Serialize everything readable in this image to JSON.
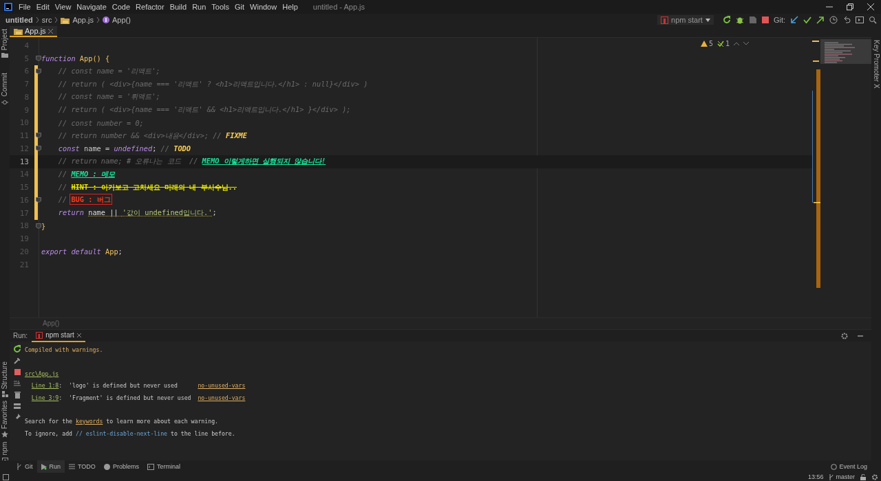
{
  "window": {
    "title": "untitled - App.js",
    "menu": [
      "File",
      "Edit",
      "View",
      "Navigate",
      "Code",
      "Refactor",
      "Build",
      "Run",
      "Tools",
      "Git",
      "Window",
      "Help"
    ]
  },
  "navbar": {
    "breadcrumbs": [
      {
        "label": "untitled",
        "kind": "project"
      },
      {
        "label": "src",
        "kind": "folder"
      },
      {
        "label": "App.js",
        "kind": "file"
      },
      {
        "label": "App()",
        "kind": "function"
      }
    ],
    "run_config": "npm start",
    "git_label": "Git:"
  },
  "left_tool_windows": [
    {
      "label": "Project",
      "kind": "folder"
    },
    {
      "label": "Commit",
      "kind": "commit"
    },
    {
      "label": "Structure",
      "kind": "structure"
    },
    {
      "label": "Favorites",
      "kind": "star"
    },
    {
      "label": "npm",
      "kind": "npm"
    }
  ],
  "right_tool_windows": [
    {
      "label": "Key Promoter X"
    }
  ],
  "editor": {
    "tabs": [
      {
        "label": "App.js",
        "selected": true
      }
    ],
    "inspections": {
      "warnings": "5",
      "weak_warnings": "1"
    },
    "lines": [
      {
        "number": "4",
        "changed": false,
        "current": false,
        "fold": false
      },
      {
        "number": "5",
        "changed": false,
        "current": false,
        "fold": true,
        "tokens": [
          {
            "kind": "keyword",
            "text": "function "
          },
          {
            "kind": "function",
            "text": "App() {"
          }
        ]
      },
      {
        "number": "6",
        "changed": true,
        "current": false,
        "fold": true,
        "tokens": [
          {
            "kind": "comment",
            "text": "    // const name = '리액트';"
          }
        ]
      },
      {
        "number": "7",
        "changed": true,
        "current": false,
        "fold": false,
        "tokens": [
          {
            "kind": "comment",
            "text": "    // return ( <div>{name === '리액트' ? <h1>리액트입니다.</h1> : null}</div> )"
          }
        ]
      },
      {
        "number": "8",
        "changed": true,
        "current": false,
        "fold": false,
        "tokens": [
          {
            "kind": "comment",
            "text": "    // const name = '뤼액트';"
          }
        ]
      },
      {
        "number": "9",
        "changed": true,
        "current": false,
        "fold": false,
        "tokens": [
          {
            "kind": "comment",
            "text": "    // return ( <div>{name === '리액트' && <h1>리액트입니다.</h1> }</div> );"
          }
        ]
      },
      {
        "number": "10",
        "changed": true,
        "current": false,
        "fold": false,
        "tokens": [
          {
            "kind": "comment",
            "text": "    // const number = 0;"
          }
        ]
      },
      {
        "number": "11",
        "changed": true,
        "current": false,
        "fold": true,
        "tokens": [
          {
            "kind": "comment",
            "text": "    // return number && <div>내용</div>; // "
          },
          {
            "kind": "todo",
            "text": "FIXME"
          }
        ]
      },
      {
        "number": "12",
        "changed": true,
        "current": false,
        "fold": true,
        "tokens": [
          {
            "kind": "keyword",
            "text": "    const"
          },
          {
            "kind": "plain",
            "text": " name = "
          },
          {
            "kind": "keyword",
            "text": "undefined"
          },
          {
            "kind": "plain",
            "text": "; "
          },
          {
            "kind": "comment",
            "text": "// "
          },
          {
            "kind": "todo",
            "text": "TODO"
          }
        ]
      },
      {
        "number": "13",
        "changed": true,
        "current": true,
        "fold": false,
        "tokens": [
          {
            "kind": "comment",
            "text": "    // return name; # 오류나는 코드  // "
          },
          {
            "kind": "memo",
            "text": "MEMO 이렇게하면 실행되지 않습니다!"
          }
        ]
      },
      {
        "number": "14",
        "changed": true,
        "current": false,
        "fold": false,
        "tokens": [
          {
            "kind": "comment",
            "text": "    // "
          },
          {
            "kind": "memo",
            "text": "MEMO : 메모"
          }
        ]
      },
      {
        "number": "15",
        "changed": true,
        "current": false,
        "fold": false,
        "tokens": [
          {
            "kind": "comment",
            "text": "    // "
          },
          {
            "kind": "hint",
            "text": "HINT : 이거보고 고치세요 미래의 내 부사수님.."
          }
        ]
      },
      {
        "number": "16",
        "changed": true,
        "current": false,
        "fold": true,
        "tokens": [
          {
            "kind": "comment",
            "text": "    // "
          },
          {
            "kind": "bug",
            "text": "BUG : 버그"
          }
        ]
      },
      {
        "number": "17",
        "changed": true,
        "current": false,
        "fold": false,
        "tokens": [
          {
            "kind": "keyword",
            "text": "    return "
          },
          {
            "kind": "warn",
            "text": "name || "
          },
          {
            "kind": "warn_string",
            "text": "'값이 undefined입니다.'"
          },
          {
            "kind": "plain",
            "text": ";"
          }
        ]
      },
      {
        "number": "18",
        "changed": false,
        "current": false,
        "fold": true,
        "tokens": [
          {
            "kind": "function",
            "text": "}"
          }
        ]
      },
      {
        "number": "19",
        "changed": false,
        "current": false,
        "fold": false
      },
      {
        "number": "20",
        "changed": false,
        "current": false,
        "fold": false,
        "tokens": [
          {
            "kind": "keyword",
            "text": "export default "
          },
          {
            "kind": "function",
            "text": "App"
          },
          {
            "kind": "plain",
            "text": ";"
          }
        ]
      },
      {
        "number": "21",
        "changed": false,
        "current": false,
        "fold": false
      }
    ],
    "breadcrumb": "App()"
  },
  "run_panel": {
    "label": "Run:",
    "tabs": [
      {
        "label": "npm start",
        "selected": true
      }
    ],
    "output_blocks": [
      [
        [
          {
            "kind": "warning",
            "text": "Compiled with warnings."
          }
        ]
      ],
      [
        [
          {
            "kind": "link",
            "text": "src\\App.js"
          }
        ],
        [
          {
            "kind": "indent"
          },
          {
            "kind": "link",
            "text": "Line 1:8"
          },
          {
            "kind": "plain",
            "text": ":  'logo' is defined but never used      "
          },
          {
            "kind": "rule",
            "text": "no-unused-vars"
          }
        ],
        [
          {
            "kind": "indent"
          },
          {
            "kind": "link",
            "text": "Line 3:9"
          },
          {
            "kind": "plain",
            "text": ":  'Fragment' is defined but never used  "
          },
          {
            "kind": "rule",
            "text": "no-unused-vars"
          }
        ]
      ],
      [
        [
          {
            "kind": "plain",
            "text": "Search for the "
          },
          {
            "kind": "rule",
            "text": "keywords"
          },
          {
            "kind": "plain",
            "text": " to learn more about each warning."
          }
        ],
        [
          {
            "kind": "plain",
            "text": "To ignore, add "
          },
          {
            "kind": "code",
            "text": "// eslint-disable-next-line"
          },
          {
            "kind": "plain",
            "text": " to the line before."
          }
        ]
      ]
    ]
  },
  "bottom_tabs": [
    {
      "label": "Git",
      "kind": "git",
      "selected": false
    },
    {
      "label": "Run",
      "kind": "run",
      "selected": true
    },
    {
      "label": "TODO",
      "kind": "todo",
      "selected": false
    },
    {
      "label": "Problems",
      "kind": "problems",
      "selected": false
    },
    {
      "label": "Terminal",
      "kind": "terminal",
      "selected": false
    }
  ],
  "event_log": "Event Log",
  "status_bar": {
    "time": "13:56",
    "branch": "master"
  }
}
